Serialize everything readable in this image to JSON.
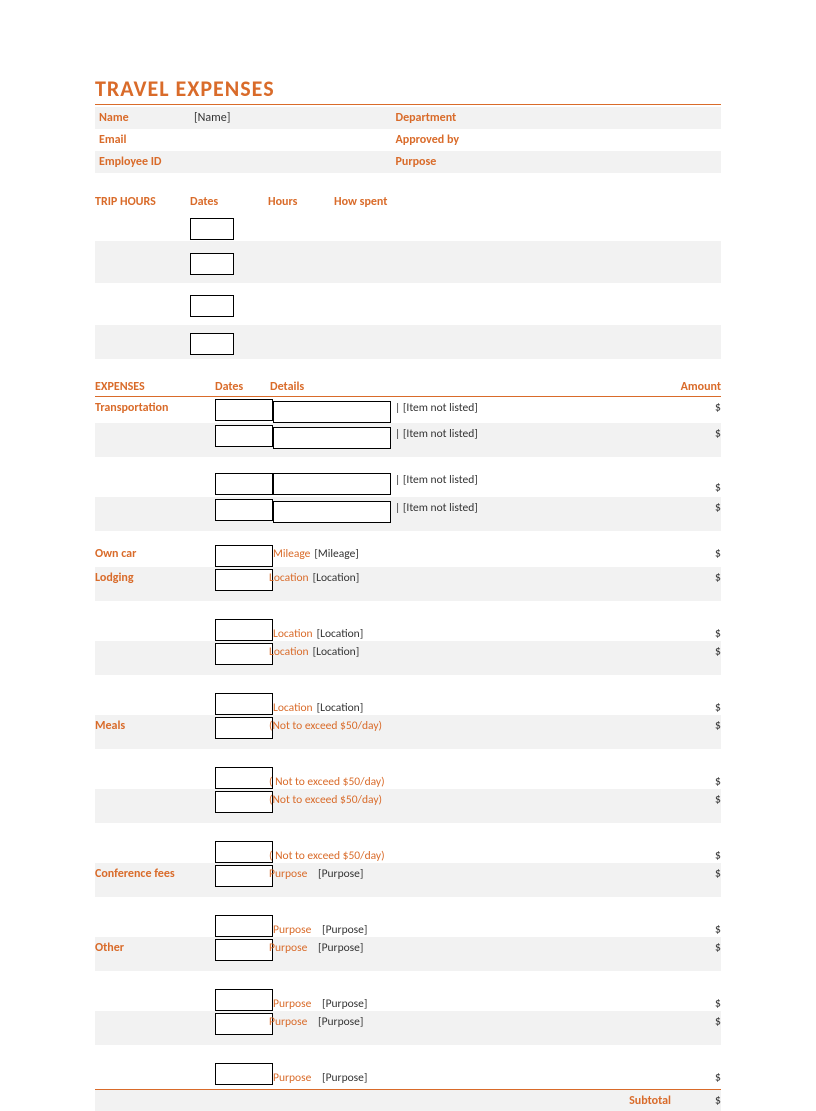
{
  "title": "TRAVEL EXPENSES",
  "info": {
    "name_label": "Name",
    "name_value": "[Name]",
    "department_label": "Department",
    "department_value": "",
    "email_label": "Email",
    "email_value": "",
    "approved_label": "Approved by",
    "approved_value": "",
    "empid_label": "Employee ID",
    "empid_value": "",
    "purpose_label": "Purpose",
    "purpose_value": ""
  },
  "trip": {
    "section": "TRIP HOURS",
    "dates_label": "Dates",
    "hours_label": "Hours",
    "howspent_label": "How spent"
  },
  "expenses": {
    "section": "EXPENSES",
    "dates_label": "Dates",
    "details_label": "Details",
    "amount_label": "Amount"
  },
  "cat": {
    "transportation": "Transportation",
    "owncar": "Own car",
    "lodging": "Lodging",
    "meals": "Meals",
    "conference": "Conference fees",
    "other": "Other"
  },
  "detail": {
    "pipe_item": "| [Item not listed]",
    "mileage_label": "Mileage",
    "mileage_val": "[Mileage]",
    "location_label": "Location",
    "location_val": "[Location]",
    "meals_note": "(Not to exceed $50/day)",
    "meals_note_sp": "( Not to exceed $50/day)",
    "purpose_label": "Purpose",
    "purpose_val": "[Purpose]"
  },
  "currency": "$",
  "subtotal_label": "Subtotal"
}
